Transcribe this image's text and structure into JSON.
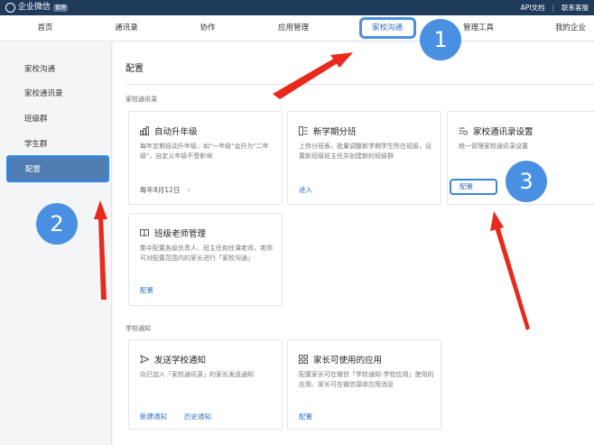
{
  "topbar": {
    "app_name": "企业微信",
    "badge": "管理",
    "links": [
      "API文档",
      "|",
      "联系客服"
    ]
  },
  "nav": {
    "items": [
      {
        "label": "首页"
      },
      {
        "label": "通讯录"
      },
      {
        "label": "协作"
      },
      {
        "label": "应用管理"
      },
      {
        "label": "家校沟通"
      },
      {
        "label": "管理工具"
      },
      {
        "label": "我的企业"
      }
    ]
  },
  "sidebar": {
    "items": [
      {
        "label": "家校沟通"
      },
      {
        "label": "家校通讯录"
      },
      {
        "label": "班级群"
      },
      {
        "label": "学生群"
      },
      {
        "label": "配置"
      }
    ]
  },
  "main": {
    "title": "配置",
    "section1": "家校通讯录",
    "section2": "学校通知",
    "cards": {
      "auto_upgrade": {
        "title": "自动升年级",
        "desc": "每年定期自动升年级，如\"一年级\"会升为\"二年级\"，自定义年级不受影响",
        "meta": "每年8月12日",
        "chevron": "›"
      },
      "new_term": {
        "title": "新学期分班",
        "desc": "上传分班表，批量调整新学期学生所在班级，设置新班级班主任并创建新的班级群",
        "link": "进入"
      },
      "contacts_settings": {
        "title": "家校通讯录设置",
        "desc": "统一管理家校通讯录设置",
        "button": "配置"
      },
      "teacher_mgmt": {
        "title": "班级老师管理",
        "desc": "集中配置各级负责人、班主任和任课老师，老师可对配置范围内的家长进行「家校沟通」",
        "link": "配置"
      },
      "send_notice": {
        "title": "发送学校通知",
        "desc": "向已加入「家校通讯录」的家长发送通知",
        "link1": "新建通知",
        "link2": "历史通知"
      },
      "parent_apps": {
        "title": "家长可使用的应用",
        "desc": "配置家长可在微信「学校通知-学校应用」使用的应用、家长可在微信接收应用消息",
        "link": "配置"
      }
    }
  },
  "annotations": {
    "badge1": "1",
    "badge2": "2",
    "badge3": "3",
    "arrow_color": "#e8291c",
    "highlight_color": "#3b86db"
  }
}
